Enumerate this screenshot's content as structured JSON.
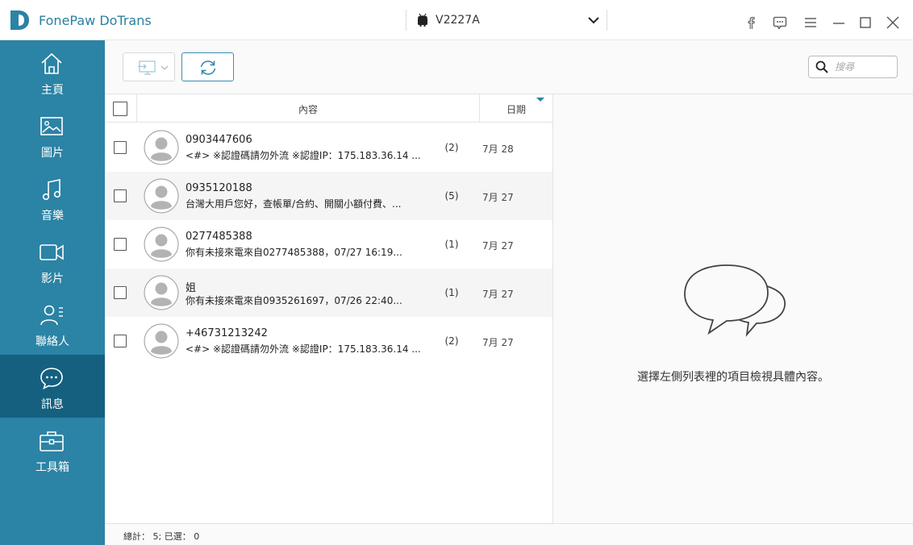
{
  "app": {
    "title": "FonePaw DoTrans",
    "device_name": "V2227A"
  },
  "sidebar": {
    "items": [
      {
        "label": "主頁",
        "icon": "home-icon"
      },
      {
        "label": "圖片",
        "icon": "photo-icon"
      },
      {
        "label": "音樂",
        "icon": "music-icon"
      },
      {
        "label": "影片",
        "icon": "video-icon"
      },
      {
        "label": "聯絡人",
        "icon": "contacts-icon"
      },
      {
        "label": "訊息",
        "icon": "message-icon",
        "active": true
      },
      {
        "label": "工具箱",
        "icon": "toolbox-icon"
      }
    ]
  },
  "toolbar": {
    "search_placeholder": "搜尋"
  },
  "list": {
    "header_content": "內容",
    "header_date": "日期",
    "rows": [
      {
        "sender": "0903447606",
        "preview": "<#> ※認證碼請勿外流 ※認證IP：175.183.36.14 ...",
        "count": "(2)",
        "date": "7月 28"
      },
      {
        "sender": "0935120188",
        "preview": "台灣大用戶您好，查帳單/合約、開關小額付費、...",
        "count": "(5)",
        "date": "7月 27"
      },
      {
        "sender": "0277485388",
        "preview": "你有未接來電來自0277485388，07/27 16:19...",
        "count": "(1)",
        "date": "7月 27"
      },
      {
        "sender": "姐",
        "preview": "你有未接來電來自0935261697，07/26 22:40...",
        "count": "(1)",
        "date": "7月 27"
      },
      {
        "sender": "+46731213242",
        "preview": "<#> ※認證碼請勿外流 ※認證IP：175.183.36.14 ...",
        "count": "(2)",
        "date": "7月 27"
      }
    ]
  },
  "detail": {
    "empty_text": "選擇左側列表裡的項目檢視具體內容。"
  },
  "status": {
    "text": "總計： 5; 已選： 0"
  },
  "colors": {
    "sidebar": "#2b83a5",
    "sidebar_active": "#15607f",
    "accent": "#2b83a5"
  }
}
